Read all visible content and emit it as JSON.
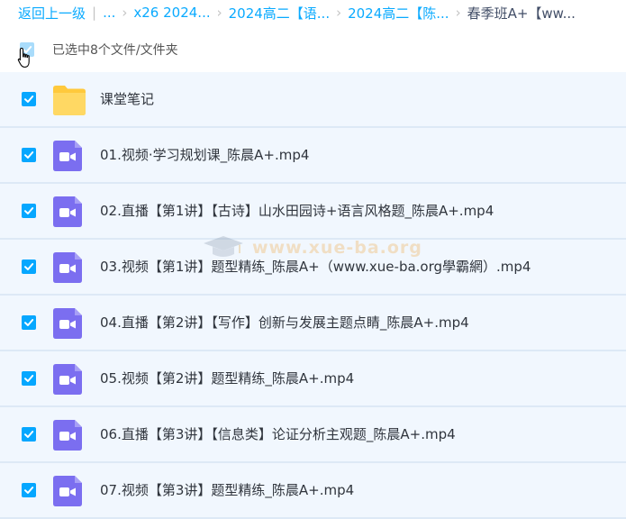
{
  "breadcrumb": {
    "back_label": "返回上一级",
    "ellipsis": "...",
    "crumbs": [
      "x26 2024...",
      "2024高二【语...",
      "2024高二【陈..."
    ],
    "current": "春季班A+【ww..."
  },
  "selection": {
    "label": "已选中8个文件/文件夹"
  },
  "items": [
    {
      "name": "课堂笔记",
      "type": "folder"
    },
    {
      "name": "01.视频·学习规划课_陈晨A+.mp4",
      "type": "video"
    },
    {
      "name": "02.直播【第1讲】【古诗】山水田园诗+语言风格题_陈晨A+.mp4",
      "type": "video"
    },
    {
      "name": "03.视频【第1讲】题型精练_陈晨A+（www.xue-ba.org學霸網）.mp4",
      "type": "video"
    },
    {
      "name": "04.直播【第2讲】【写作】创新与发展主题点睛_陈晨A+.mp4",
      "type": "video"
    },
    {
      "name": "05.视频【第2讲】题型精练_陈晨A+.mp4",
      "type": "video"
    },
    {
      "name": "06.直播【第3讲】【信息类】论证分析主观题_陈晨A+.mp4",
      "type": "video"
    },
    {
      "name": "07.视频【第3讲】题型精练_陈晨A+.mp4",
      "type": "video"
    }
  ],
  "watermark": "www.xue-ba.org",
  "colors": {
    "accent": "#06a7ff",
    "link": "#09aaff",
    "row_bg": "#f1f7fe",
    "video_icon": "#7b6ef0",
    "folder_icon": "#ffcf48"
  }
}
